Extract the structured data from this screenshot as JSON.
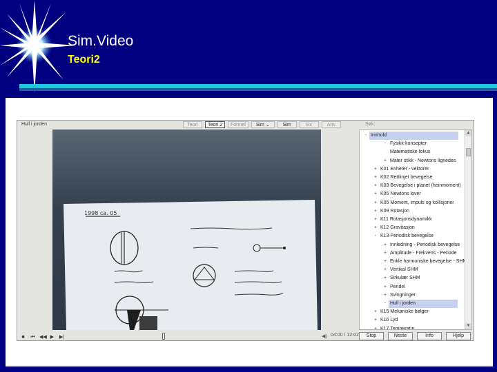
{
  "slide": {
    "title": "Sim.Video",
    "subtitle": "Teori2"
  },
  "player": {
    "document_title": "Hull i jorden",
    "tabs": [
      {
        "label": "Teori",
        "active": false
      },
      {
        "label": "Teori 2",
        "active": true
      },
      {
        "label": "Formel",
        "active": false
      },
      {
        "label": "Sim",
        "active": false,
        "dropdown": true
      },
      {
        "label": "Sim",
        "active": false
      },
      {
        "label": "Ex",
        "active": false
      },
      {
        "label": "Ans",
        "active": false
      }
    ],
    "search_label": "Søk:",
    "tree": [
      {
        "toggle": "-",
        "label": "Innhold",
        "indent": 0,
        "selected": true
      },
      {
        "toggle": "-",
        "label": "Fysikk-konsepter",
        "indent": 2,
        "selected": false
      },
      {
        "toggle": "",
        "label": "Matematiske fokus",
        "indent": 2,
        "selected": false
      },
      {
        "toggle": "+",
        "label": "Mater stikk - Newtons lignedes",
        "indent": 2,
        "selected": false
      },
      {
        "toggle": "+",
        "label": "K01 Enheter - vektorer",
        "indent": 1,
        "selected": false
      },
      {
        "toggle": "+",
        "label": "K02 Rettlinjet bevegelse",
        "indent": 1,
        "selected": false
      },
      {
        "toggle": "+",
        "label": "K03 Bevegelse i planet (heinmoment)",
        "indent": 1,
        "selected": false
      },
      {
        "toggle": "+",
        "label": "K05 Newtons lover",
        "indent": 1,
        "selected": false
      },
      {
        "toggle": "+",
        "label": "K05 Moment, impuls og kollisjoner",
        "indent": 1,
        "selected": false
      },
      {
        "toggle": "+",
        "label": "K09 Rotasjon",
        "indent": 1,
        "selected": false
      },
      {
        "toggle": "+",
        "label": "K11 Rotasjonsdynamikk",
        "indent": 1,
        "selected": false
      },
      {
        "toggle": "+",
        "label": "K12 Gravitasjon",
        "indent": 1,
        "selected": false
      },
      {
        "toggle": "-",
        "label": "K13 Periodisk bevegelse",
        "indent": 1,
        "selected": false
      },
      {
        "toggle": "+",
        "label": "Innledning - Periodisk bevegelse",
        "indent": 2,
        "selected": false
      },
      {
        "toggle": "+",
        "label": "Amplitude - Frekvens - Periode",
        "indent": 2,
        "selected": false
      },
      {
        "toggle": "+",
        "label": "Enkle harmoniske bevegelse - SHM",
        "indent": 2,
        "selected": false
      },
      {
        "toggle": "+",
        "label": "Vertikal SHM",
        "indent": 2,
        "selected": false
      },
      {
        "toggle": "+",
        "label": "Sirkulær SHM",
        "indent": 2,
        "selected": false
      },
      {
        "toggle": "+",
        "label": "Pendel",
        "indent": 2,
        "selected": false
      },
      {
        "toggle": "+",
        "label": "Svingninger",
        "indent": 2,
        "selected": false
      },
      {
        "toggle": "-",
        "label": "Hull i jorden",
        "indent": 2,
        "selected": true
      },
      {
        "toggle": "+",
        "label": "K15 Mekaniske bølger",
        "indent": 1,
        "selected": false
      },
      {
        "toggle": "+",
        "label": "K16 Lyd",
        "indent": 1,
        "selected": false
      },
      {
        "toggle": "+",
        "label": "K17 Temperatur",
        "indent": 1,
        "selected": false
      }
    ],
    "timecode": "04:00 / 12:02",
    "buttons": {
      "stop": "Stop",
      "next": "Neste",
      "info": "Info",
      "help": "Hjelp"
    },
    "playback_progress": 0.0
  },
  "colors": {
    "background": "#000080",
    "title": "#ffffff",
    "subtitle": "#ffff00",
    "rule": "#1ec8d8",
    "selection": "#c8d0f0"
  }
}
